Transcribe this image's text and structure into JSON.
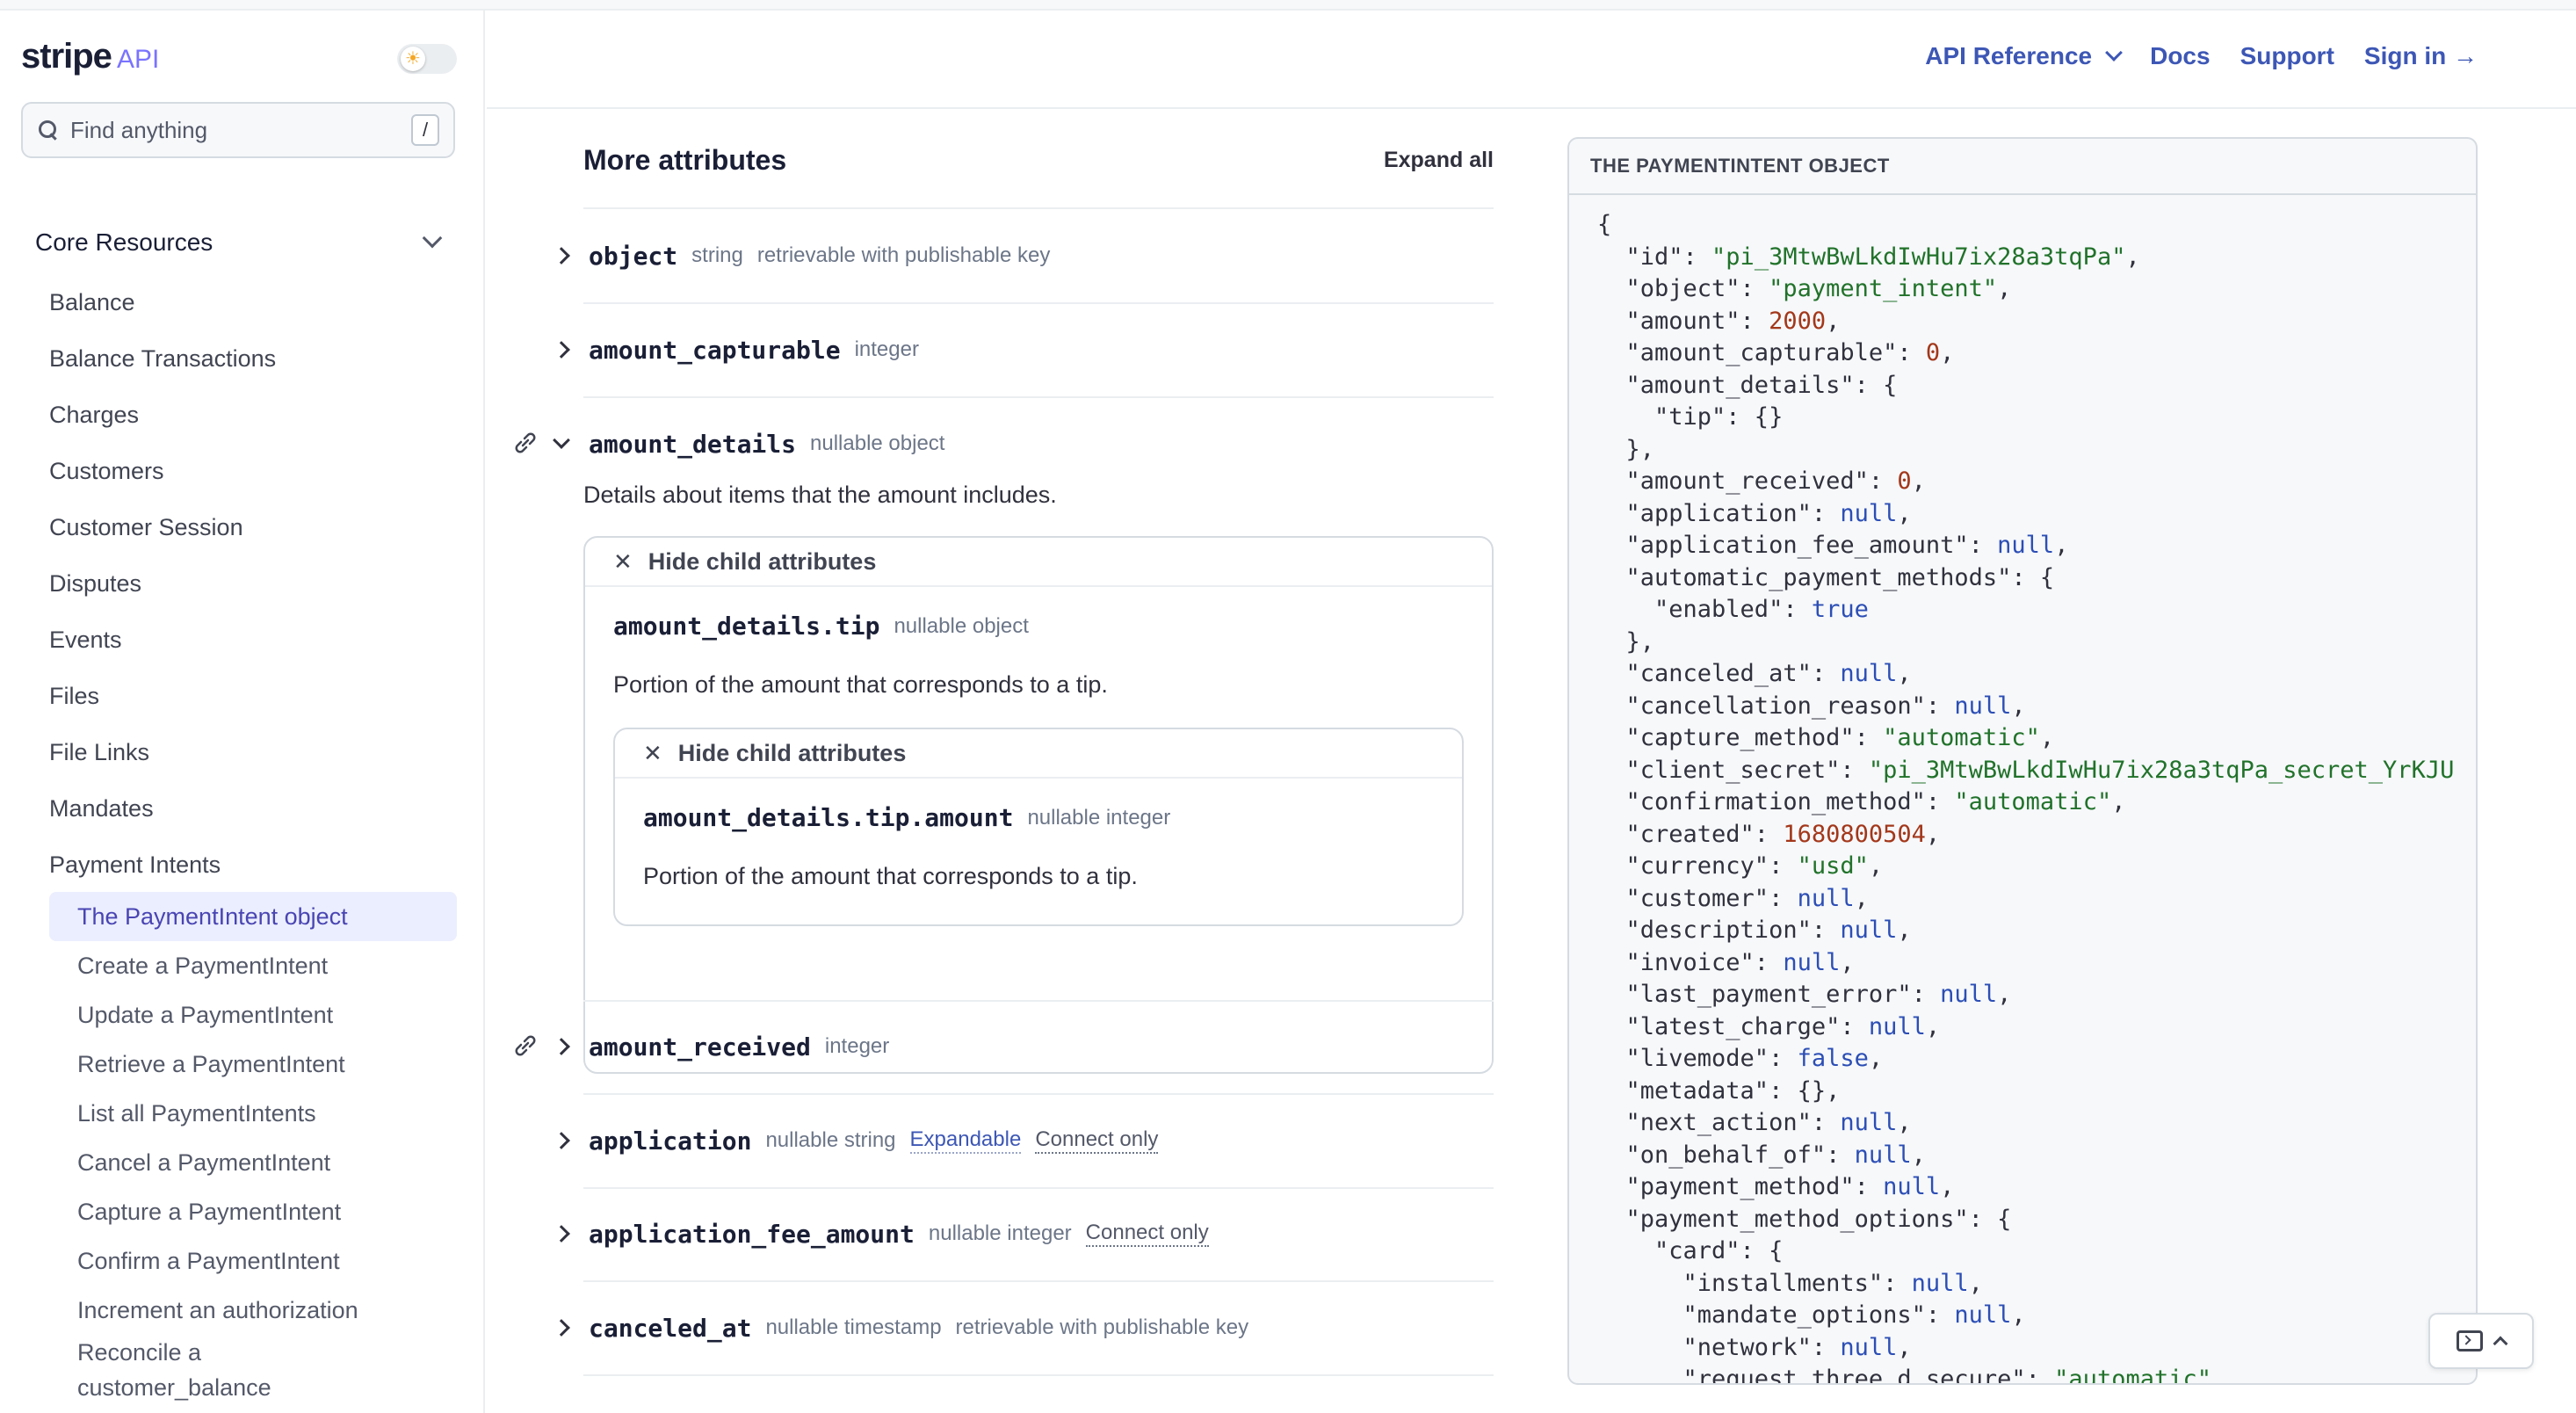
{
  "logo": {
    "brand": "stripe",
    "product": "API"
  },
  "search": {
    "placeholder": "Find anything",
    "shortcut": "/"
  },
  "sidebar": {
    "section": "Core Resources",
    "items": [
      "Balance",
      "Balance Transactions",
      "Charges",
      "Customers",
      "Customer Session",
      "Disputes",
      "Events",
      "Files",
      "File Links",
      "Mandates",
      "Payment Intents"
    ],
    "subitems": [
      "The PaymentIntent object",
      "Create a PaymentIntent",
      "Update a PaymentIntent",
      "Retrieve a PaymentIntent",
      "List all PaymentIntents",
      "Cancel a PaymentIntent",
      "Capture a PaymentIntent",
      "Confirm a PaymentIntent",
      "Increment an authorization",
      "Reconcile a customer_balance PaymentIntent"
    ]
  },
  "header": {
    "api_reference": "API Reference",
    "docs": "Docs",
    "support": "Support",
    "sign_in": "Sign in →"
  },
  "main": {
    "title": "More attributes",
    "expand_all": "Expand all",
    "attrs": {
      "object": {
        "name": "object",
        "type": "string",
        "meta": "retrievable with publishable key"
      },
      "amount_capturable": {
        "name": "amount_capturable",
        "type": "integer"
      },
      "amount_details": {
        "name": "amount_details",
        "type": "nullable object",
        "desc": "Details about items that the amount includes.",
        "hide_label": "Hide child attributes",
        "tip": {
          "name": "amount_details.tip",
          "type": "nullable object",
          "desc": "Portion of the amount that corresponds to a tip.",
          "hide_label": "Hide child attributes",
          "amount": {
            "name": "amount_details.tip.amount",
            "type": "nullable integer",
            "desc": "Portion of the amount that corresponds to a tip."
          }
        }
      },
      "amount_received": {
        "name": "amount_received",
        "type": "integer"
      },
      "application": {
        "name": "application",
        "type": "nullable string",
        "tag1": "Expandable",
        "tag2": "Connect only"
      },
      "application_fee_amount": {
        "name": "application_fee_amount",
        "type": "nullable integer",
        "tag": "Connect only"
      },
      "canceled_at": {
        "name": "canceled_at",
        "type": "nullable timestamp",
        "meta": "retrievable with publishable key"
      }
    }
  },
  "code": {
    "title": "THE PAYMENTINTENT OBJECT",
    "lines": [
      [
        [
          "k",
          "{"
        ]
      ],
      [
        [
          "k",
          "  \"id\": "
        ],
        [
          "s",
          "\"pi_3MtwBwLkdIwHu7ix28a3tqPa\""
        ],
        [
          "k",
          ","
        ]
      ],
      [
        [
          "k",
          "  \"object\": "
        ],
        [
          "s",
          "\"payment_intent\""
        ],
        [
          "k",
          ","
        ]
      ],
      [
        [
          "k",
          "  \"amount\": "
        ],
        [
          "n",
          "2000"
        ],
        [
          "k",
          ","
        ]
      ],
      [
        [
          "k",
          "  \"amount_capturable\": "
        ],
        [
          "n",
          "0"
        ],
        [
          "k",
          ","
        ]
      ],
      [
        [
          "k",
          "  \"amount_details\": {"
        ]
      ],
      [
        [
          "k",
          "    \"tip\": {}"
        ]
      ],
      [
        [
          "k",
          "  },"
        ]
      ],
      [
        [
          "k",
          "  \"amount_received\": "
        ],
        [
          "n",
          "0"
        ],
        [
          "k",
          ","
        ]
      ],
      [
        [
          "k",
          "  \"application\": "
        ],
        [
          "b",
          "null"
        ],
        [
          "k",
          ","
        ]
      ],
      [
        [
          "k",
          "  \"application_fee_amount\": "
        ],
        [
          "b",
          "null"
        ],
        [
          "k",
          ","
        ]
      ],
      [
        [
          "k",
          "  \"automatic_payment_methods\": {"
        ]
      ],
      [
        [
          "k",
          "    \"enabled\": "
        ],
        [
          "b",
          "true"
        ]
      ],
      [
        [
          "k",
          "  },"
        ]
      ],
      [
        [
          "k",
          "  \"canceled_at\": "
        ],
        [
          "b",
          "null"
        ],
        [
          "k",
          ","
        ]
      ],
      [
        [
          "k",
          "  \"cancellation_reason\": "
        ],
        [
          "b",
          "null"
        ],
        [
          "k",
          ","
        ]
      ],
      [
        [
          "k",
          "  \"capture_method\": "
        ],
        [
          "s",
          "\"automatic\""
        ],
        [
          "k",
          ","
        ]
      ],
      [
        [
          "k",
          "  \"client_secret\": "
        ],
        [
          "s",
          "\"pi_3MtwBwLkdIwHu7ix28a3tqPa_secret_YrKJU"
        ]
      ],
      [
        [
          "k",
          "  \"confirmation_method\": "
        ],
        [
          "s",
          "\"automatic\""
        ],
        [
          "k",
          ","
        ]
      ],
      [
        [
          "k",
          "  \"created\": "
        ],
        [
          "n",
          "1680800504"
        ],
        [
          "k",
          ","
        ]
      ],
      [
        [
          "k",
          "  \"currency\": "
        ],
        [
          "s",
          "\"usd\""
        ],
        [
          "k",
          ","
        ]
      ],
      [
        [
          "k",
          "  \"customer\": "
        ],
        [
          "b",
          "null"
        ],
        [
          "k",
          ","
        ]
      ],
      [
        [
          "k",
          "  \"description\": "
        ],
        [
          "b",
          "null"
        ],
        [
          "k",
          ","
        ]
      ],
      [
        [
          "k",
          "  \"invoice\": "
        ],
        [
          "b",
          "null"
        ],
        [
          "k",
          ","
        ]
      ],
      [
        [
          "k",
          "  \"last_payment_error\": "
        ],
        [
          "b",
          "null"
        ],
        [
          "k",
          ","
        ]
      ],
      [
        [
          "k",
          "  \"latest_charge\": "
        ],
        [
          "b",
          "null"
        ],
        [
          "k",
          ","
        ]
      ],
      [
        [
          "k",
          "  \"livemode\": "
        ],
        [
          "b",
          "false"
        ],
        [
          "k",
          ","
        ]
      ],
      [
        [
          "k",
          "  \"metadata\": {},"
        ]
      ],
      [
        [
          "k",
          "  \"next_action\": "
        ],
        [
          "b",
          "null"
        ],
        [
          "k",
          ","
        ]
      ],
      [
        [
          "k",
          "  \"on_behalf_of\": "
        ],
        [
          "b",
          "null"
        ],
        [
          "k",
          ","
        ]
      ],
      [
        [
          "k",
          "  \"payment_method\": "
        ],
        [
          "b",
          "null"
        ],
        [
          "k",
          ","
        ]
      ],
      [
        [
          "k",
          "  \"payment_method_options\": {"
        ]
      ],
      [
        [
          "k",
          "    \"card\": {"
        ]
      ],
      [
        [
          "k",
          "      \"installments\": "
        ],
        [
          "b",
          "null"
        ],
        [
          "k",
          ","
        ]
      ],
      [
        [
          "k",
          "      \"mandate_options\": "
        ],
        [
          "b",
          "null"
        ],
        [
          "k",
          ","
        ]
      ],
      [
        [
          "k",
          "      \"network\": "
        ],
        [
          "b",
          "null"
        ],
        [
          "k",
          ","
        ]
      ],
      [
        [
          "k",
          "      \"request_three_d_secure\": "
        ],
        [
          "s",
          "\"automatic\""
        ]
      ]
    ]
  },
  "colors": {
    "accent": "#635bff",
    "link": "#3d57b5",
    "active_bg": "#ebeefe",
    "string": "#21722a",
    "number": "#a3371a",
    "keyword": "#2c4eb5"
  }
}
